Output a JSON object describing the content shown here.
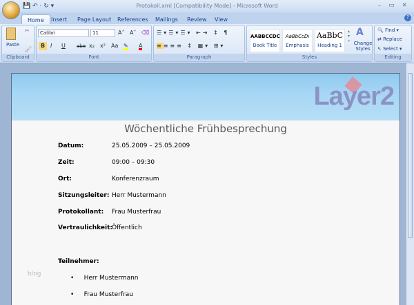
{
  "window": {
    "title": "Protokoll.xml [Compatibility Mode] - Microsoft Word",
    "controls": "– ▭ ✕"
  },
  "qat": {
    "icons": "💾 ↶ · ↻ ▾"
  },
  "tabs": [
    "Home",
    "Insert",
    "Page Layout",
    "References",
    "Mailings",
    "Review",
    "View"
  ],
  "ribbon": {
    "clipboard": {
      "label": "Clipboard",
      "paste": "Paste"
    },
    "font": {
      "label": "Font",
      "name": "Calibri",
      "size": "11",
      "grow": "A˄",
      "shrink": "A˅",
      "bold": "B",
      "italic": "I",
      "underline": "U",
      "strike": "abe",
      "sub": "x₂",
      "sup": "x²",
      "case": "Aa"
    },
    "paragraph": {
      "label": "Paragraph"
    },
    "styles": {
      "label": "Styles",
      "items": [
        {
          "preview": "AABBCCDC",
          "name": "Book Title"
        },
        {
          "preview": "AaBbCcDı",
          "name": "Emphasis"
        },
        {
          "preview": "AaBbC",
          "name": "Heading 1"
        }
      ],
      "change": "Change Styles"
    },
    "editing": {
      "label": "Editing",
      "find": "Find",
      "replace": "Replace",
      "select": "Select"
    }
  },
  "document": {
    "logo": "Layer2",
    "title": "Wöchentliche Frühbesprechung",
    "fields": [
      {
        "label": "Datum:",
        "value": "25.05.2009 – 25.05.2009"
      },
      {
        "label": "Zeit:",
        "value": "09:00 – 09:30"
      },
      {
        "label": "Ort:",
        "value": "Konferenzraum"
      },
      {
        "label": "Sitzungsleiter:",
        "value": "Herr Mustermann"
      },
      {
        "label": "Protokollant:",
        "value": "Frau Musterfrau"
      },
      {
        "label": "Vertraulichkeit:",
        "value": "Öffentlich"
      }
    ],
    "participants_label": "Teilnehmer:",
    "participants": [
      "Herr Mustermann",
      "Frau Musterfrau"
    ],
    "watermark": "blog"
  }
}
